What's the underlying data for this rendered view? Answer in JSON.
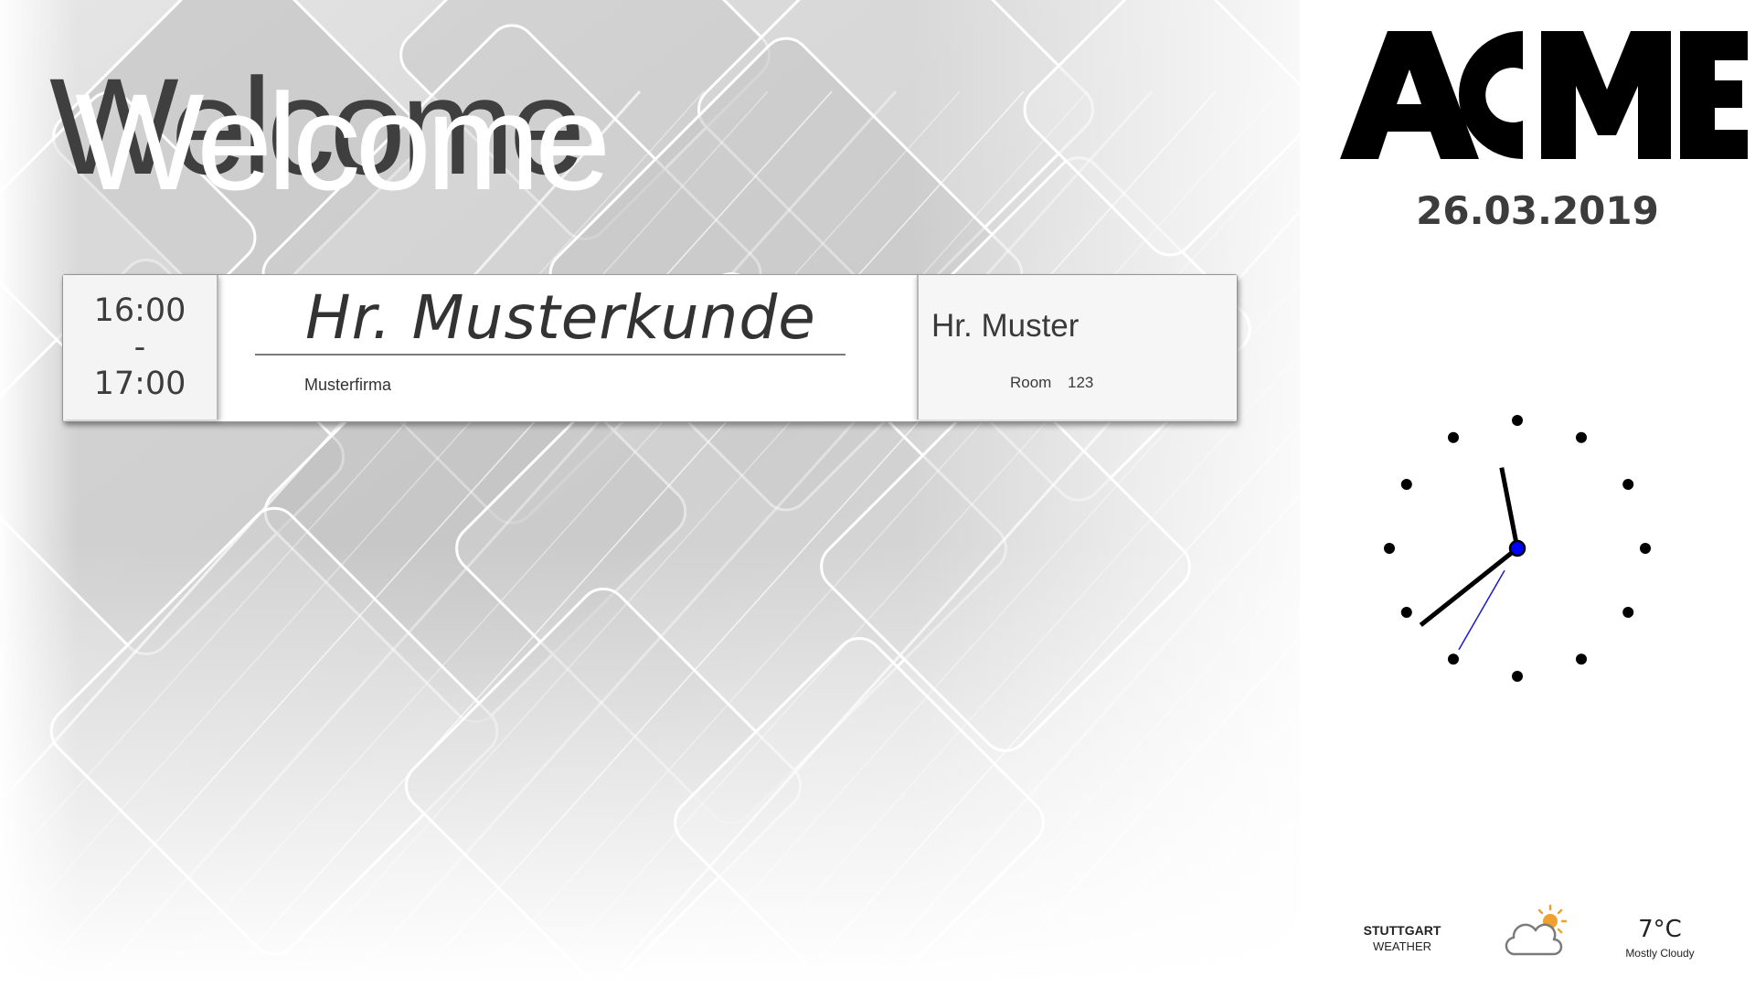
{
  "header": {
    "welcome_text": "Welcome"
  },
  "appointment": {
    "time_start": "16:00",
    "time_separator": "-",
    "time_end": "17:00",
    "guest_name": "Hr. Musterkunde",
    "guest_company": "Musterfirma",
    "host_name": "Hr. Muster",
    "room_label": "Room",
    "room_number": "123"
  },
  "branding": {
    "logo_text": "ACME"
  },
  "date": "26.03.2019",
  "clock": {
    "hours": 11,
    "minutes": 38,
    "seconds": 35
  },
  "weather": {
    "city": "STUTTGART",
    "label": "WEATHER",
    "temperature": "7°C",
    "condition": "Mostly Cloudy",
    "icon": "partly-cloudy-icon"
  },
  "colors": {
    "text_dark": "#3c3c3c",
    "clock_center": "#0000ff",
    "second_hand": "#1a1acc",
    "sun": "#f0a030",
    "cloud_outline": "#7a7a7a"
  }
}
